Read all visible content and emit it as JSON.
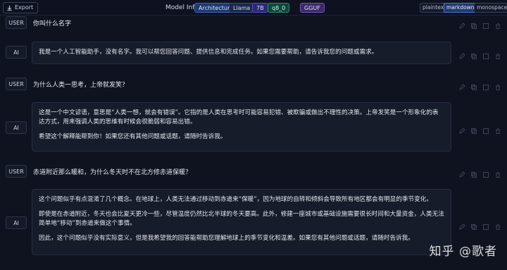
{
  "topbar": {
    "export_label": "Export",
    "model_info_label": "Model Info",
    "architecture_label": "Architecture",
    "architecture_value": "Llama",
    "param_size": "7B",
    "quant": "q8_0",
    "format": "GGUF",
    "view_modes": [
      "plaintext",
      "markdown",
      "monospace"
    ],
    "active_view_mode": "markdown"
  },
  "messages": [
    {
      "role": "USER",
      "text": "你叫什么名字"
    },
    {
      "role": "AI",
      "paragraphs": [
        "我是一个人工智能助手，没有名字。我可以帮您回答问题、提供信息和完成任务。如果您需要帮助，请告诉我您的问题或需求。"
      ]
    },
    {
      "role": "USER",
      "text": "为什么人类一思考，上帝就发笑？"
    },
    {
      "role": "AI",
      "paragraphs": [
        "这是一个中文谚语，意思是“人类一想，就会有错误”。它指的是人类在思考时可能容易犯错、被欺骗或做出不理性的决策。上帝发笑是一个形象化的表达方式，用来强调人类的思维有时候会很脆弱和容易出错。",
        "希望这个解释能帮到你！如果您还有其他问题或话题，请随时告诉我。"
      ]
    },
    {
      "role": "USER",
      "text": "赤道附近那么暖和，为什么冬天时不在北方修赤道保暖？"
    },
    {
      "role": "AI",
      "paragraphs": [
        "这个问题似乎有点混淆了几个概念。在地球上，人类无法通过移动到赤道来“保暖”，因为地球的自转和倾斜会导致所有地区都会有明显的季节变化。",
        "即使是在赤道附近，冬天也会比夏天更冷一些，尽管温度仍然比北半球的冬天要高。此外，修建一座城市或基础设施需要很长时间和大量资金，人类无法简单地“移动”到赤道来做这个事情。",
        "因此，这个问题似乎没有实际意义，但是我希望我的回答能帮助您理解地球上的季节变化和温差。如果您有其他问题或话题，请随时告诉我。"
      ]
    }
  ],
  "watermark": "知乎 @歌者",
  "colors": {
    "background": "#0f1320",
    "bubble": "#171c2a",
    "accent": "#4b74d6"
  }
}
